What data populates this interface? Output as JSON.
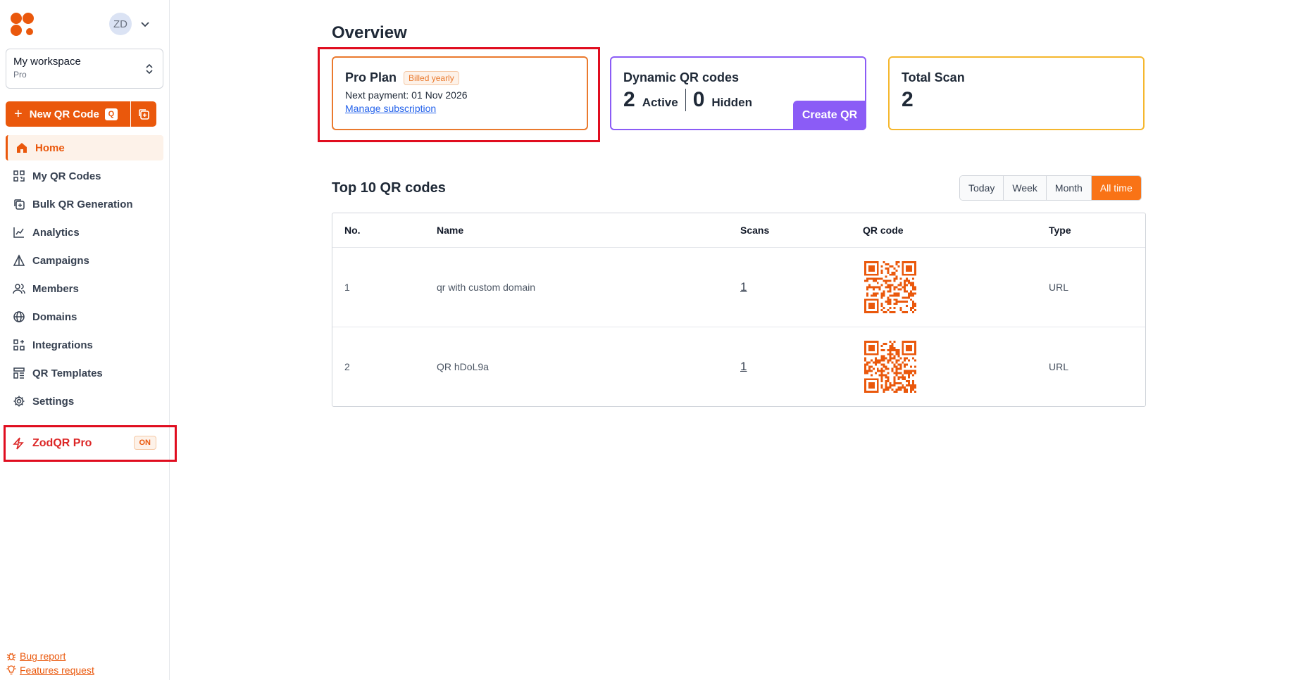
{
  "user": {
    "initials": "ZD"
  },
  "workspace": {
    "name": "My workspace",
    "plan": "Pro"
  },
  "new_qr": {
    "label": "New QR Code",
    "shortcut": "Q"
  },
  "nav": [
    {
      "label": "Home",
      "icon": "home-icon"
    },
    {
      "label": "My QR Codes",
      "icon": "qr-grid-icon"
    },
    {
      "label": "Bulk QR Generation",
      "icon": "bulk-copy-icon"
    },
    {
      "label": "Analytics",
      "icon": "chart-icon"
    },
    {
      "label": "Campaigns",
      "icon": "triangle-icon"
    },
    {
      "label": "Members",
      "icon": "users-icon"
    },
    {
      "label": "Domains",
      "icon": "globe-icon"
    },
    {
      "label": "Integrations",
      "icon": "blocks-icon"
    },
    {
      "label": "QR Templates",
      "icon": "template-icon"
    },
    {
      "label": "Settings",
      "icon": "gear-icon"
    }
  ],
  "pro": {
    "label": "ZodQR Pro",
    "badge": "ON"
  },
  "footer": {
    "bug": "Bug report",
    "feature": "Features request"
  },
  "overview": {
    "title": "Overview",
    "plan_card": {
      "title": "Pro Plan",
      "badge": "Billed yearly",
      "next_payment": "Next payment: 01 Nov 2026",
      "manage": "Manage subscription"
    },
    "dynamic_card": {
      "title": "Dynamic QR codes",
      "active_count": "2",
      "active_label": "Active",
      "hidden_count": "0",
      "hidden_label": "Hidden",
      "cta": "Create QR"
    },
    "total_card": {
      "title": "Total Scan",
      "value": "2"
    }
  },
  "top": {
    "title": "Top 10 QR codes",
    "ranges": [
      "Today",
      "Week",
      "Month",
      "All time"
    ],
    "selected_range": "All time",
    "columns": [
      "No.",
      "Name",
      "Scans",
      "QR code",
      "Type"
    ],
    "rows": [
      {
        "no": "1",
        "name": "qr with custom domain",
        "scans": "1",
        "type": "URL"
      },
      {
        "no": "2",
        "name": "QR hDoL9a",
        "scans": "1",
        "type": "URL"
      }
    ]
  },
  "colors": {
    "accent": "#ea580c",
    "purple": "#8b5cf6",
    "yellow": "#f5b72e",
    "highlight": "#e00d1f"
  }
}
